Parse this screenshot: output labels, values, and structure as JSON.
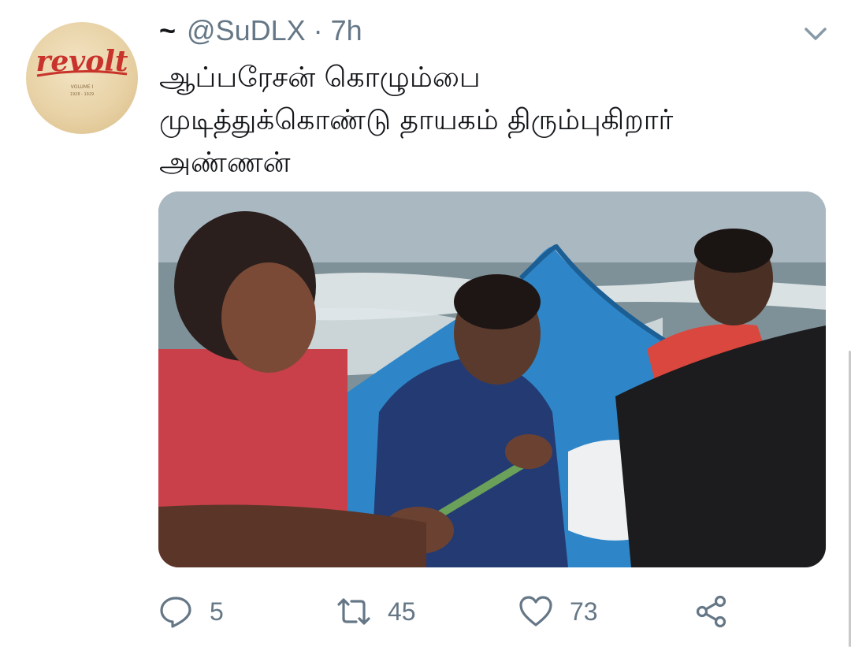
{
  "tweet": {
    "display_name": "~",
    "handle": "@SuDLX",
    "separator": "·",
    "time": "7h",
    "text_lines": [
      "ஆப்பரேசன் கொழும்பை",
      "முடித்துக்கொண்டு தாயகம் திரும்புகிறார்",
      "அண்ணன்"
    ],
    "avatar": {
      "brand_text": "revolt",
      "subtitle": "VOLUME I",
      "years": "1928 - 1929"
    },
    "media": {
      "description_icon": "photo-men-pushing-blue-boat-at-sea"
    }
  },
  "actions": {
    "reply": {
      "icon": "reply-icon",
      "count": "5"
    },
    "retweet": {
      "icon": "retweet-icon",
      "count": "45"
    },
    "like": {
      "icon": "heart-icon",
      "count": "73"
    },
    "share": {
      "icon": "share-icon"
    }
  },
  "colors": {
    "text": "#14171a",
    "secondary": "#657786",
    "avatar_brand": "#c8332b"
  }
}
